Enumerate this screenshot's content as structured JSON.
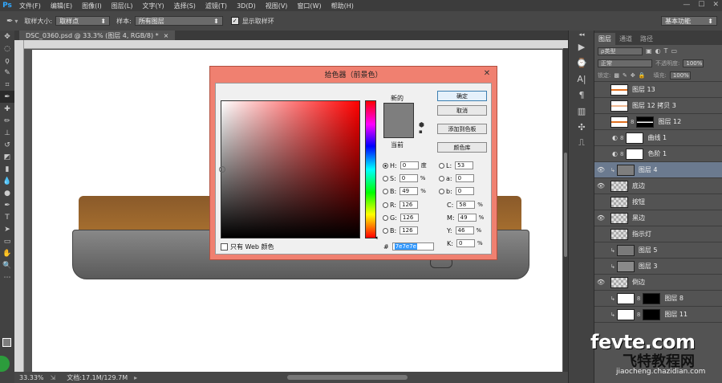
{
  "app": {
    "logo": "Ps"
  },
  "menubar": {
    "items": [
      "文件(F)",
      "编辑(E)",
      "图像(I)",
      "图层(L)",
      "文字(Y)",
      "选择(S)",
      "滤镜(T)",
      "3D(D)",
      "视图(V)",
      "窗口(W)",
      "帮助(H)"
    ],
    "window_controls": [
      "—",
      "☐",
      "✕"
    ]
  },
  "options": {
    "sample_size_label": "取样大小:",
    "sample_size_value": "取样点",
    "sample_label": "样本:",
    "sample_value": "所有图层",
    "show_ring_label": "显示取样环",
    "workspace": "基本功能"
  },
  "document": {
    "tab_title": "DSC_0360.psd @ 33.3% (图层 4, RGB/8) *",
    "tab_close": "×",
    "zoom": "33.33%",
    "doc_info": "文档:17.1M/129.7M"
  },
  "dialog": {
    "title": "拾色器（前景色）",
    "close": "✕",
    "new_label": "新的",
    "current_label": "当前",
    "ok": "确定",
    "cancel": "取消",
    "add_swatch": "添加到色板",
    "color_library": "颜色库",
    "web_only": "只有 Web 颜色",
    "fields": {
      "H": {
        "label": "H:",
        "value": "0",
        "unit": "度"
      },
      "S": {
        "label": "S:",
        "value": "0",
        "unit": "%"
      },
      "B": {
        "label": "B:",
        "value": "49",
        "unit": "%"
      },
      "R": {
        "label": "R:",
        "value": "126"
      },
      "G": {
        "label": "G:",
        "value": "126"
      },
      "Bl": {
        "label": "B:",
        "value": "126"
      },
      "L": {
        "label": "L:",
        "value": "53"
      },
      "a": {
        "label": "a:",
        "value": "0"
      },
      "b": {
        "label": "b:",
        "value": "0"
      },
      "C": {
        "label": "C:",
        "value": "58",
        "unit": "%"
      },
      "M": {
        "label": "M:",
        "value": "49",
        "unit": "%"
      },
      "Y": {
        "label": "Y:",
        "value": "46",
        "unit": "%"
      },
      "K": {
        "label": "K:",
        "value": "0",
        "unit": "%"
      }
    },
    "hex_prefix": "#",
    "hex": "7e7e7e",
    "selected_color": "#7e7e7e"
  },
  "layers_panel": {
    "tabs": [
      "图层",
      "通道",
      "路径"
    ],
    "kind_label": "ρ类型",
    "blend_mode": "正常",
    "opacity_label": "不透明度:",
    "opacity_value": "100%",
    "lock_label": "锁定:",
    "fill_label": "填充:",
    "fill_value": "100%",
    "layers": [
      {
        "name": "图层 13",
        "visible": false
      },
      {
        "name": "图层 12 拷贝 3",
        "visible": false
      },
      {
        "name": "图层 12",
        "visible": false
      },
      {
        "name": "曲线 1",
        "visible": false
      },
      {
        "name": "色阶 1",
        "visible": false
      },
      {
        "name": "图层 4",
        "visible": true,
        "selected": true
      },
      {
        "name": "底边",
        "visible": true
      },
      {
        "name": "按钮",
        "visible": false
      },
      {
        "name": "黑边",
        "visible": true
      },
      {
        "name": "指示灯",
        "visible": false
      },
      {
        "name": "图层 5",
        "visible": false
      },
      {
        "name": "图层 3",
        "visible": false
      },
      {
        "name": "倒边",
        "visible": true
      },
      {
        "name": "图层 8",
        "visible": false
      },
      {
        "name": "图层 11",
        "visible": false
      }
    ]
  },
  "watermark": {
    "main": "fevte.com",
    "cn": "飞特教程网",
    "url": "jiaocheng.chazidian.com"
  }
}
